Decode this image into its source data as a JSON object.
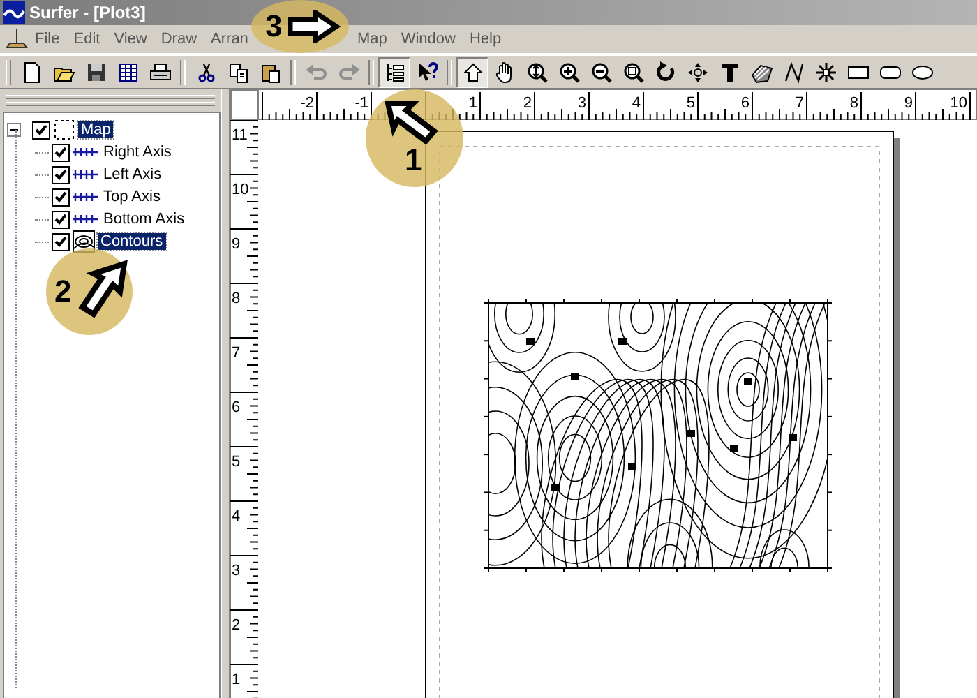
{
  "window": {
    "title": "Surfer - [Plot3]"
  },
  "menu": [
    {
      "label": "File"
    },
    {
      "label": "Edit"
    },
    {
      "label": "View"
    },
    {
      "label": "Draw"
    },
    {
      "label": "Arran"
    },
    {
      "label": "Map"
    },
    {
      "label": "Window"
    },
    {
      "label": "Help"
    }
  ],
  "toolbar": [
    {
      "disabled": false,
      "pressed": false
    },
    {
      "disabled": false,
      "pressed": false
    },
    {
      "disabled": false,
      "pressed": false
    },
    {
      "disabled": false,
      "pressed": false
    },
    {
      "disabled": false,
      "pressed": false
    },
    {
      "disabled": false,
      "pressed": false
    },
    {
      "disabled": false,
      "pressed": false
    },
    {
      "disabled": false,
      "pressed": false
    },
    {
      "disabled": true,
      "pressed": false
    },
    {
      "disabled": true,
      "pressed": false
    },
    {
      "disabled": false,
      "pressed": true
    },
    {
      "disabled": false,
      "pressed": false
    },
    {
      "disabled": false,
      "pressed": true
    },
    {
      "disabled": false,
      "pressed": false
    },
    {
      "disabled": false,
      "pressed": false
    },
    {
      "disabled": false,
      "pressed": false
    },
    {
      "disabled": false,
      "pressed": false
    },
    {
      "disabled": false,
      "pressed": false
    },
    {
      "disabled": false,
      "pressed": false
    },
    {
      "disabled": false,
      "pressed": false
    },
    {
      "disabled": false,
      "pressed": false
    },
    {
      "disabled": false,
      "pressed": false
    },
    {
      "disabled": false,
      "pressed": false
    },
    {
      "disabled": false,
      "pressed": false
    },
    {
      "disabled": false,
      "pressed": false
    },
    {
      "disabled": false,
      "pressed": false
    },
    {
      "disabled": false,
      "pressed": false
    }
  ],
  "tree": {
    "label": "Map",
    "checked": true,
    "selected": true,
    "expanded": true,
    "children": [
      {
        "kind": "axis",
        "label": "Right Axis",
        "checked": true,
        "selected": false
      },
      {
        "kind": "axis",
        "label": "Left Axis",
        "checked": true,
        "selected": false
      },
      {
        "kind": "axis",
        "label": "Top Axis",
        "checked": true,
        "selected": false
      },
      {
        "kind": "axis",
        "label": "Bottom Axis",
        "checked": true,
        "selected": false
      },
      {
        "kind": "contour",
        "label": "Contours",
        "checked": true,
        "selected": true
      }
    ]
  },
  "top_ruler": [
    "-2",
    "-1",
    "1",
    "2",
    "3",
    "4",
    "5",
    "6",
    "7",
    "8",
    "9",
    "10"
  ],
  "left_ruler": [
    "11",
    "10",
    "9",
    "8",
    "7",
    "6",
    "5",
    "4",
    "3",
    "2",
    "1"
  ],
  "callouts": [
    {
      "number": "3",
      "kind": "right"
    },
    {
      "number": "1",
      "kind": "up-left"
    },
    {
      "number": "2",
      "kind": "up-right"
    }
  ]
}
